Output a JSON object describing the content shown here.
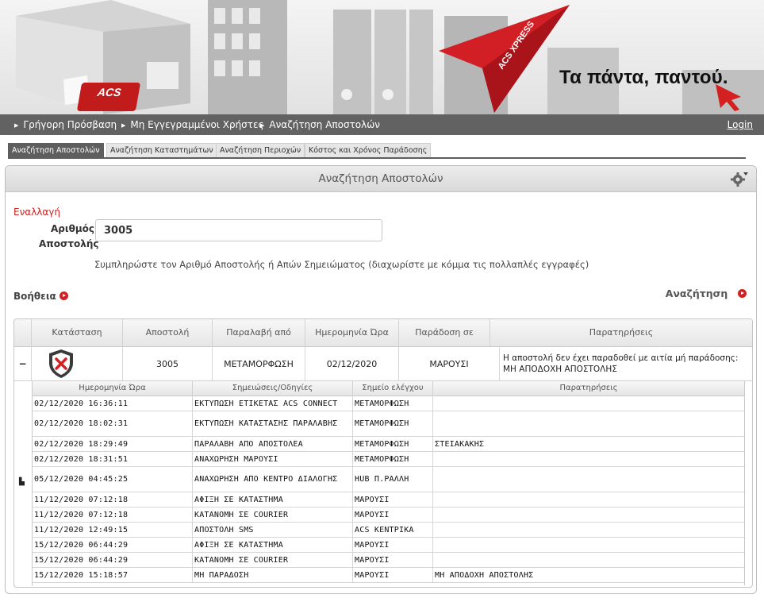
{
  "banner": {
    "logo_text": "ACS",
    "tagline_small": "ACS XPRESS",
    "slogan": "Τα πάντα, παντού."
  },
  "nav": {
    "items": [
      "Γρήγορη Πρόσβαση",
      "Μη Εγγεγραμμένοι Χρήστες",
      "Αναζήτηση Αποστολών"
    ],
    "login": "Login"
  },
  "tabs": [
    "Αναζήτηση Αποστολών",
    "Αναζήτηση Καταστημάτων",
    "Αναζήτηση Περιοχών",
    "Κόστος και Χρόνος Παράδοσης"
  ],
  "panel": {
    "title": "Αναζήτηση Αποστολών",
    "toggle": "Εναλλαγή",
    "field_label_1": "Αριθμός",
    "field_label_2": "Αποστολής",
    "field_value": "3005",
    "hint": "Συμπληρώστε τον Αριθμό Αποστολής ή Απών Σημειώματος (διαχωρίστε με κόμμα τις πολλαπλές εγγραφές)",
    "help": "Βοήθεια",
    "search": "Αναζήτηση"
  },
  "grid": {
    "headers": [
      "Κατάσταση",
      "Αποστολή",
      "Παραλαβή από",
      "Ημερομηνία Ώρα",
      "Παράδοση σε",
      "Παρατηρήσεις"
    ],
    "row": {
      "collapse": "−",
      "status_icon": "shield-x-icon",
      "shipment": "3005",
      "pickup_from": "ΜΕΤΑΜΟΡΦΩΣΗ",
      "datetime": "02/12/2020",
      "delivery_to": "ΜΑΡΟΥΣΙ",
      "remarks": "Η αποστολή δεν έχει παραδοθεί με αιτία μή παράδοσης: ΜΗ ΑΠΟΔΟΧΗ ΑΠΟΣΤΟΛΗΣ"
    }
  },
  "subgrid": {
    "headers": [
      "Ημερομηνία Ώρα",
      "Σημειώσεις/Οδηγίες",
      "Σημείο ελέγχου",
      "Παρατηρήσεις"
    ],
    "rows": [
      [
        "02/12/2020 16:36:11",
        "ΕΚΤΥΠΩΣΗ ΕΤΙΚΕΤΑΣ ACS CONNECT",
        "ΜΕΤΑΜΟΡΦΩΣΗ",
        ""
      ],
      [
        "02/12/2020 18:02:31",
        "ΕΚΤΥΠΩΣΗ ΚΑΤΑΣΤΑΣΗΣ ΠΑΡΑΛΑΒΗΣ",
        "ΜΕΤΑΜΟΡΦΩΣΗ",
        ""
      ],
      [
        "02/12/2020 18:29:49",
        "ΠΑΡΑΛΑΒΗ ΑΠΟ ΑΠΟΣΤΟΛΕΑ",
        "ΜΕΤΑΜΟΡΦΩΣΗ",
        "ΣΤΕΙΑΚΑΚΗΣ"
      ],
      [
        "02/12/2020 18:31:51",
        "ΑΝΑΧΩΡΗΣΗ ΜΑΡΟΥΣΙ",
        "ΜΕΤΑΜΟΡΦΩΣΗ",
        ""
      ],
      [
        "05/12/2020 04:45:25",
        "ΑΝΑΧΩΡΗΣΗ ΑΠΟ ΚΕΝΤΡΟ ΔΙΑΛΟΓΗΣ",
        "HUB Π.ΡΑΛΛΗ",
        ""
      ],
      [
        "11/12/2020 07:12:18",
        "ΑΦΙΞΗ ΣΕ ΚΑΤΑΣΤΗΜΑ",
        "ΜΑΡΟΥΣΙ",
        ""
      ],
      [
        "11/12/2020 07:12:18",
        "ΚΑΤΑΝΟΜΗ ΣΕ COURIER",
        "ΜΑΡΟΥΣΙ",
        ""
      ],
      [
        "11/12/2020 12:49:15",
        "ΑΠΟΣΤΟΛΗ SMS",
        "ACS ΚΕΝΤΡΙΚΑ",
        ""
      ],
      [
        "15/12/2020 06:44:29",
        "ΑΦΙΞΗ ΣΕ ΚΑΤΑΣΤΗΜΑ",
        "ΜΑΡΟΥΣΙ",
        ""
      ],
      [
        "15/12/2020 06:44:29",
        "ΚΑΤΑΝΟΜΗ ΣΕ COURIER",
        "ΜΑΡΟΥΣΙ",
        ""
      ],
      [
        "15/12/2020 15:18:57",
        "ΜΗ ΠΑΡΑΔΟΣΗ",
        "ΜΑΡΟΥΣΙ",
        "ΜΗ ΑΠΟΔΟΧΗ ΑΠΟΣΤΟΛΗΣ"
      ]
    ]
  },
  "colors": {
    "brand_red": "#d42020",
    "nav_bg": "#626262"
  }
}
